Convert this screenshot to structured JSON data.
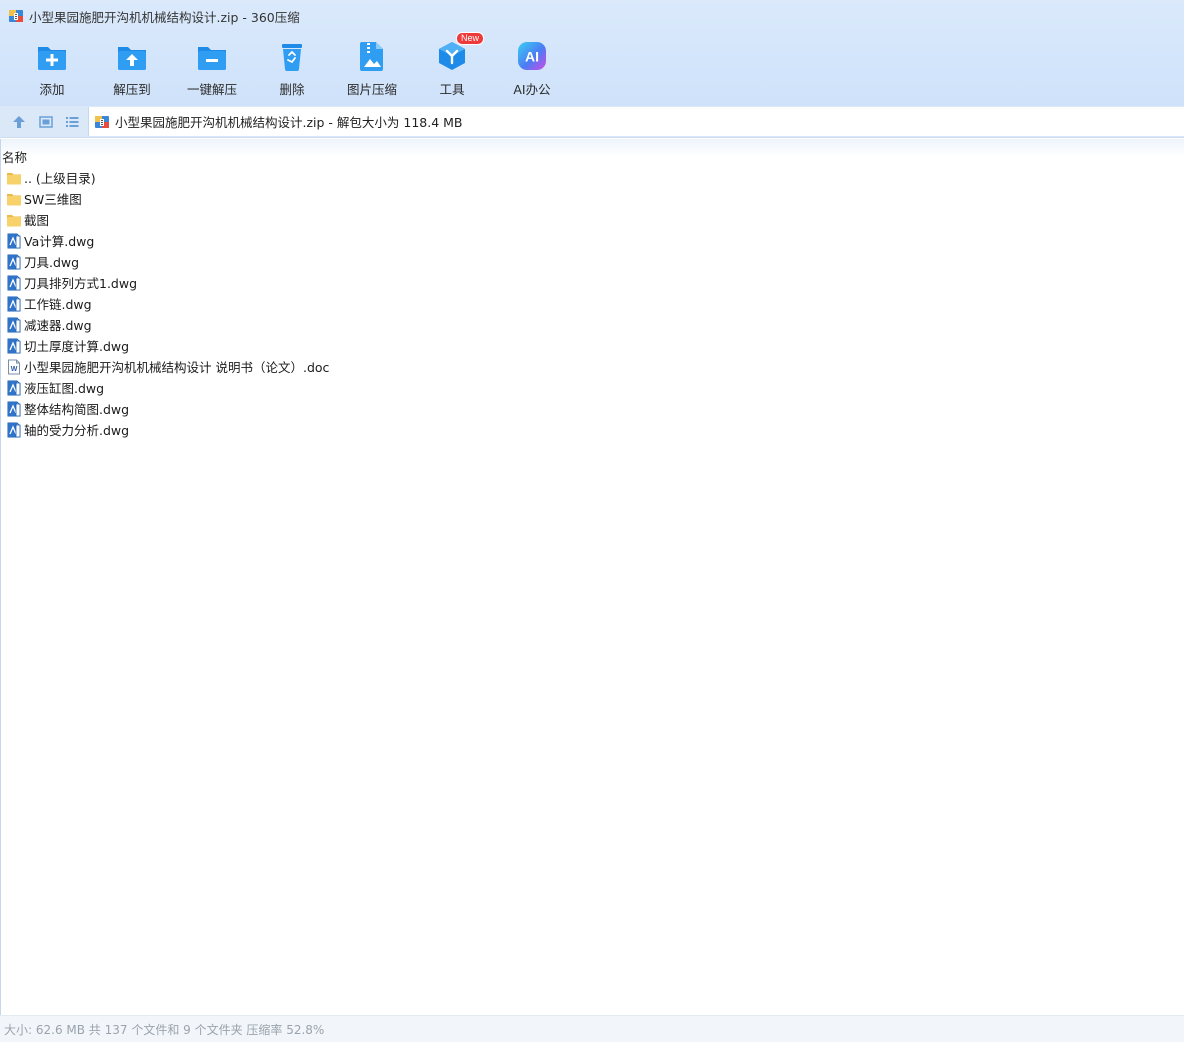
{
  "window": {
    "title": "小型果园施肥开沟机机械结构设计.zip - 360压缩"
  },
  "toolbar": {
    "items": [
      {
        "label": "添加",
        "icon": "add-icon"
      },
      {
        "label": "解压到",
        "icon": "extract-to-icon"
      },
      {
        "label": "一键解压",
        "icon": "one-click-extract-icon"
      },
      {
        "label": "删除",
        "icon": "delete-icon"
      },
      {
        "label": "图片压缩",
        "icon": "image-compress-icon"
      },
      {
        "label": "工具",
        "icon": "tools-icon",
        "badge": "New"
      },
      {
        "label": "AI办公",
        "icon": "ai-office-icon",
        "glyph": "AI"
      }
    ]
  },
  "address": {
    "text": "小型果园施肥开沟机机械结构设计.zip - 解包大小为 118.4 MB"
  },
  "list": {
    "column_header": "名称",
    "rows": [
      {
        "name": ".. (上级目录)",
        "type": "folder"
      },
      {
        "name": "SW三维图",
        "type": "folder"
      },
      {
        "name": "截图",
        "type": "folder"
      },
      {
        "name": "Va计算.dwg",
        "type": "dwg"
      },
      {
        "name": "刀具.dwg",
        "type": "dwg"
      },
      {
        "name": "刀具排列方式1.dwg",
        "type": "dwg"
      },
      {
        "name": "工作链.dwg",
        "type": "dwg"
      },
      {
        "name": "减速器.dwg",
        "type": "dwg"
      },
      {
        "name": "切土厚度计算.dwg",
        "type": "dwg"
      },
      {
        "name": "小型果园施肥开沟机机械结构设计 说明书（论文）.doc",
        "type": "doc"
      },
      {
        "name": "液压缸图.dwg",
        "type": "dwg"
      },
      {
        "name": "整体结构简图.dwg",
        "type": "dwg"
      },
      {
        "name": "轴的受力分析.dwg",
        "type": "dwg"
      }
    ]
  },
  "status": {
    "text": "大小: 62.6 MB 共 137 个文件和 9 个文件夹 压缩率 52.8%"
  },
  "colors": {
    "accent": "#1e8be8",
    "header_bg": "#d6e6fb",
    "badge": "#ee3a3a",
    "folder": "#f7d26a"
  }
}
